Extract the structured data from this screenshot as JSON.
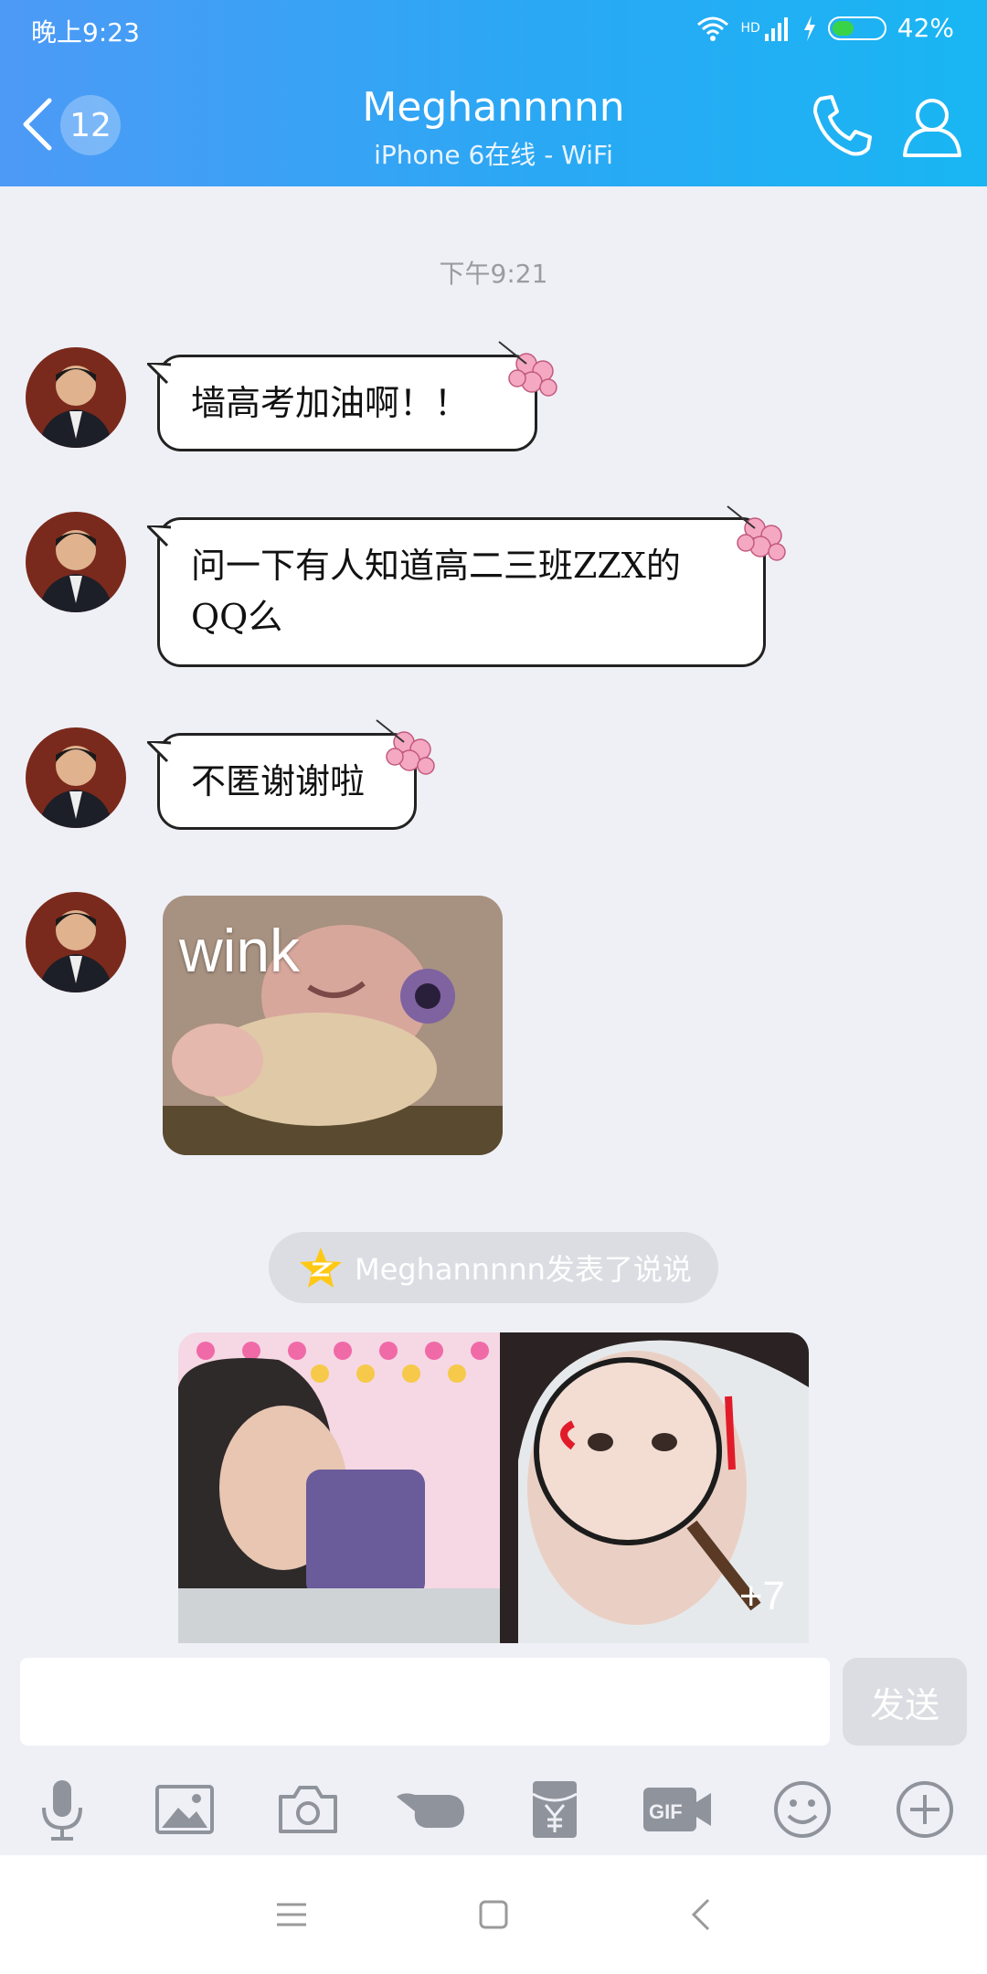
{
  "status_bar": {
    "time": "晚上9:23",
    "network": "HD",
    "battery": "42%",
    "battery_level": 0.42
  },
  "header": {
    "unread_count": "12",
    "title": "Meghannnnn",
    "subtitle": "iPhone 6在线 - WiFi"
  },
  "timestamp": "下午9:21",
  "messages": [
    {
      "text": "墙高考加油啊！！"
    },
    {
      "line1": "问一下有人知道高二三班ZZX的",
      "line2": "QQ么"
    },
    {
      "text": "不匿谢谢啦"
    }
  ],
  "sticker": {
    "caption": "wink"
  },
  "feed": {
    "text": "Meghannnnn发表了说说",
    "more_count": "+7"
  },
  "input": {
    "placeholder": "",
    "send_label": "发送"
  },
  "colors": {
    "header_start": "#4d9af6",
    "header_end": "#19b6f3",
    "background": "#eff0f6",
    "bubble_border": "#222222"
  },
  "toolbar_icons": [
    "microphone-icon",
    "image-icon",
    "camera-icon",
    "poke-icon",
    "red-packet-icon",
    "gif-icon",
    "emoji-icon",
    "plus-icon"
  ],
  "nav_icons": [
    "menu-icon",
    "home-icon",
    "back-icon"
  ]
}
